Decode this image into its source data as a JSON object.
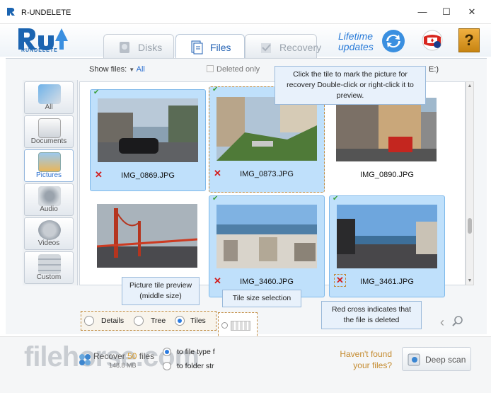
{
  "window": {
    "title": "R-UNDELETE",
    "min": "—",
    "max": "☐",
    "close": "✕"
  },
  "header": {
    "logo_text": "RUNDELETE",
    "tabs": [
      {
        "label": "Disks",
        "icon": "disk-icon"
      },
      {
        "label": "Files",
        "icon": "files-icon"
      },
      {
        "label": "Recovery",
        "icon": "recovery-icon"
      }
    ],
    "lifetime": "Lifetime updates",
    "help": "?"
  },
  "toolbar": {
    "show_files_label": "Show files:",
    "show_files_value": "All",
    "deleted_only": "Deleted only",
    "drive_suffix": "E:)"
  },
  "categories": [
    {
      "label": "All",
      "icon": "all-media-icon"
    },
    {
      "label": "Documents",
      "icon": "documents-icon"
    },
    {
      "label": "Pictures",
      "icon": "pictures-icon"
    },
    {
      "label": "Audio",
      "icon": "audio-icon"
    },
    {
      "label": "Videos",
      "icon": "videos-icon"
    },
    {
      "label": "Custom",
      "icon": "custom-icon"
    }
  ],
  "tiles": [
    {
      "name": "IMG_0869.JPG",
      "state": "sel",
      "deleted": true
    },
    {
      "name": "IMG_0873.JPG",
      "state": "focus",
      "deleted": true
    },
    {
      "name": "IMG_0890.JPG",
      "state": "none",
      "deleted": false
    },
    {
      "name": "",
      "state": "none",
      "deleted": false
    },
    {
      "name": "IMG_3460.JPG",
      "state": "sel",
      "deleted": true
    },
    {
      "name": "IMG_3461.JPG",
      "state": "sel",
      "deleted": true
    }
  ],
  "tooltips": {
    "click_tile": "Click the tile to mark the picture for recovery Double-click or right-click it to preview.",
    "preview": "Picture tile preview (middle size)",
    "size_sel": "Tile size selection",
    "red_cross": "Red cross indicates that the file is deleted"
  },
  "view_modes": [
    {
      "label": "Details",
      "on": false
    },
    {
      "label": "Tree",
      "on": false
    },
    {
      "label": "Tiles",
      "on": true
    }
  ],
  "bottom": {
    "recover_prefix": "Recover ",
    "recover_count": "50",
    "recover_suffix": " files",
    "recover_size": "148.8 MB",
    "to_file_type": "to file type f",
    "to_folder": "to folder str",
    "havent": "Haven't found your files?",
    "deep_scan": "Deep scan",
    "watermark": "filehorse.com"
  }
}
